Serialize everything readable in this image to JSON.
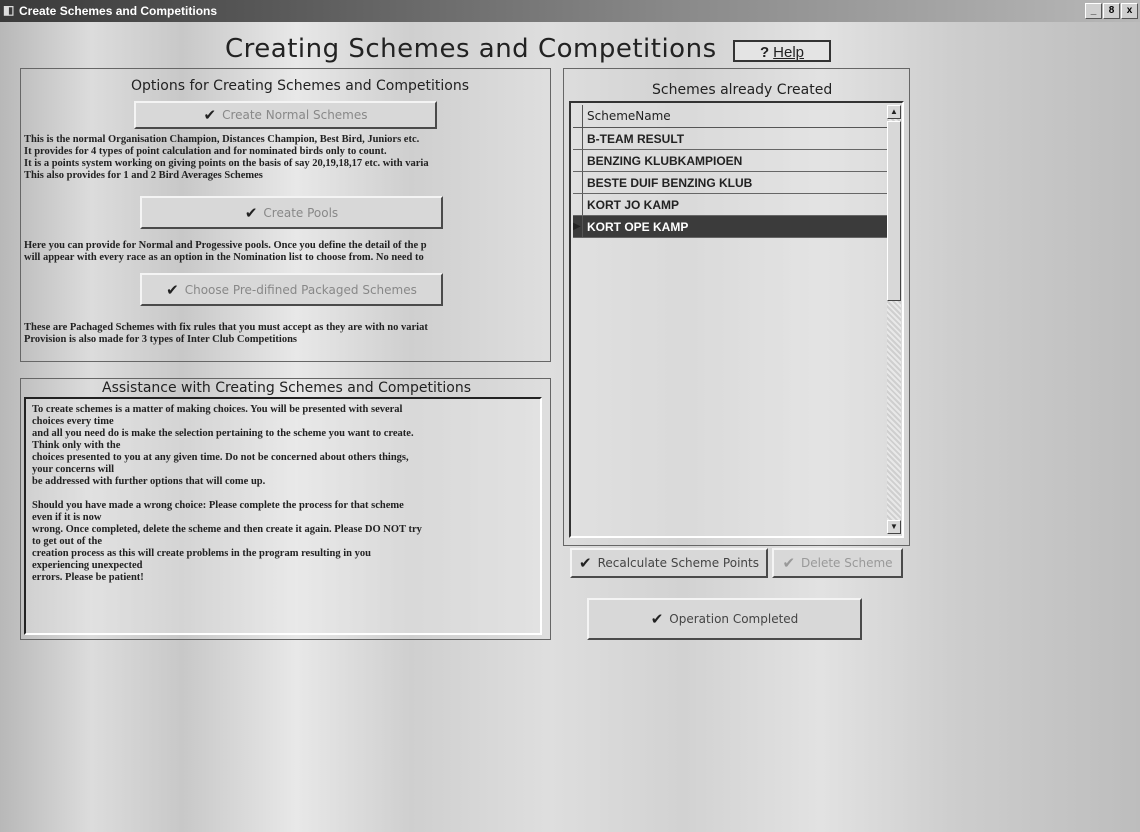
{
  "window": {
    "title": "Create Schemes and Competitions",
    "icon": "app-icon",
    "controls": [
      "_",
      "8",
      "x"
    ]
  },
  "heading": {
    "title": "Creating Schemes and Competitions",
    "help_mark": "?",
    "help_label": "Help"
  },
  "options": {
    "heading": "Options for Creating Schemes and Competitions",
    "normal_button": "Create Normal Schemes",
    "normal_desc": [
      "This is the normal Organisation Champion, Distances Champion, Best Bird, Juniors etc.",
      "It provides for 4 types of point calculation and for nominated birds only to count.",
      "It is a points system working on giving points on the basis of say 20,19,18,17 etc. with varia",
      "This also provides for 1 and 2 Bird Averages Schemes"
    ],
    "pools_button": "Create Pools",
    "pools_desc": [
      "Here you can provide for Normal and Progessive pools.  Once you define the detail of the p",
      "will appear with every race as an option in the Nomination list to choose from. No need to"
    ],
    "packaged_button": "Choose Pre-difined Packaged Schemes",
    "packaged_desc": [
      "These are Pachaged Schemes with fix rules that you must accept as they are with no variat",
      "Provision is also made for 3 types of Inter Club Competitions"
    ]
  },
  "assistance": {
    "heading": "Assistance with Creating Schemes and Competitions",
    "lines": [
      "To create schemes is a matter of making choices. You will be presented with several",
      "choices every time",
      "and all you need do is make the selection pertaining to the scheme you want to create.",
      "Think only with the",
      "choices presented to you at any given time. Do not be concerned about others things,",
      "your concerns will",
      "be addressed with further options that will come up.",
      "",
      "Should you have made a wrong choice: Please complete the process for that scheme",
      "even if it is now",
      "wrong. Once completed, delete the scheme and then create it again. Please DO NOT try",
      "to get out of the",
      "creation process as this will create problems in the program resulting in you",
      "experiencing unexpected",
      "errors. Please be patient!"
    ]
  },
  "schemes": {
    "heading": "Schemes already Created",
    "column": "SchemeName",
    "rows": [
      {
        "name": "B-TEAM RESULT",
        "selected": false
      },
      {
        "name": "BENZING KLUBKAMPIOEN",
        "selected": false
      },
      {
        "name": "BESTE DUIF BENZING KLUB",
        "selected": false
      },
      {
        "name": "KORT JO KAMP",
        "selected": false
      },
      {
        "name": "KORT OPE KAMP",
        "selected": true
      }
    ],
    "recalc_button": "Recalculate Scheme Points",
    "delete_button": "Delete Scheme"
  },
  "completed_button": "Operation Completed",
  "icons": {
    "check": "✔",
    "row_pointer": "▶",
    "scroll_up": "▲",
    "scroll_down": "▼"
  }
}
